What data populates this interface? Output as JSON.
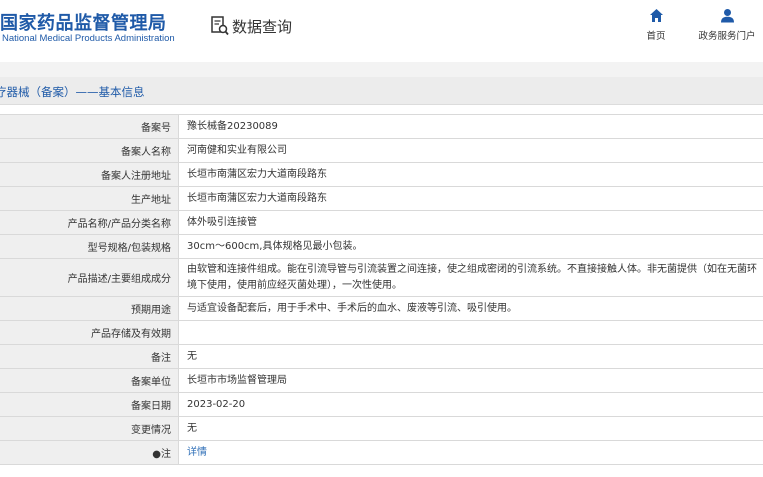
{
  "header": {
    "logo_cn": "国家药品监督管理局",
    "logo_en": "National Medical Products Administration",
    "query_label": "数据查询",
    "nav": {
      "home_label": "首页",
      "gov_label": "政务服务门户"
    }
  },
  "section": {
    "title": "疗器械（备案）——基本信息"
  },
  "rows": [
    {
      "label": "备案号",
      "value": "豫长械备20230089"
    },
    {
      "label": "备案人名称",
      "value": "河南健和实业有限公司"
    },
    {
      "label": "备案人注册地址",
      "value": "长垣市南蒲区宏力大道南段路东"
    },
    {
      "label": "生产地址",
      "value": "长垣市南蒲区宏力大道南段路东"
    },
    {
      "label": "产品名称/产品分类名称",
      "value": "体外吸引连接管"
    },
    {
      "label": "型号规格/包装规格",
      "value": "30cm～600cm,具体规格见最小包装。"
    },
    {
      "label": "产品描述/主要组成成分",
      "value": "由软管和连接件组成。能在引流导管与引流装置之间连接，使之组成密闭的引流系统。不直接接触人体。非无菌提供（如在无菌环境下使用，使用前应经灭菌处理），一次性使用。"
    },
    {
      "label": "预期用途",
      "value": "与适宜设备配套后，用于手术中、手术后的血水、废液等引流、吸引使用。"
    },
    {
      "label": "产品存储及有效期",
      "value": ""
    },
    {
      "label": "备注",
      "value": "无"
    },
    {
      "label": "备案单位",
      "value": "长垣市市场监督管理局"
    },
    {
      "label": "备案日期",
      "value": "2023-02-20"
    },
    {
      "label": "变更情况",
      "value": "无"
    },
    {
      "label": "●注",
      "value": "详情"
    }
  ],
  "colors": {
    "brand_blue": "#1f5aa8",
    "link_blue": "#2f6fb7",
    "label_bg": "#efefef",
    "title_bar_bg": "#ececec"
  },
  "icons": {
    "query": "document-search-icon",
    "home": "home-icon",
    "gov": "user-icon"
  }
}
